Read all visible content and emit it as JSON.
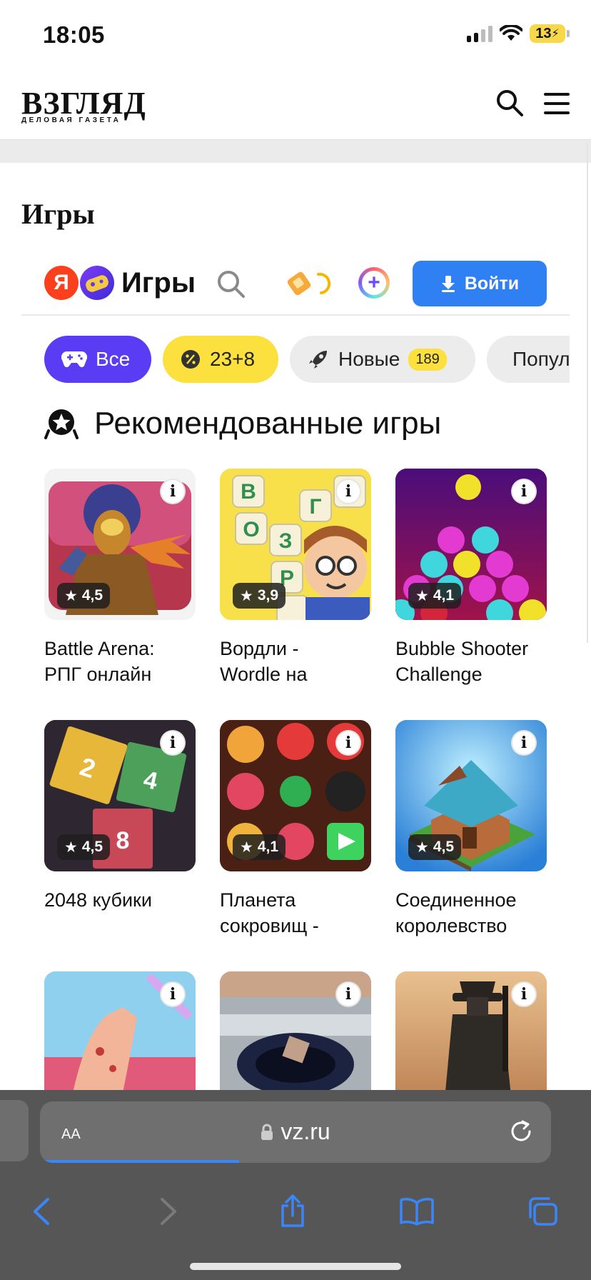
{
  "status_bar": {
    "time": "18:05",
    "battery": "13"
  },
  "site": {
    "logo": "ВЗГЛЯД",
    "logo_sub": "ДЕЛОВАЯ ГАЗЕТА",
    "page_title": "Игры"
  },
  "widget": {
    "yandex_letter": "Я",
    "brand": "Игры",
    "login_label": "Войти"
  },
  "chips": [
    {
      "label": "Все"
    },
    {
      "label": "23+8"
    },
    {
      "label": "Новые",
      "badge": "189"
    },
    {
      "label": "Популярные"
    }
  ],
  "section_title": "Рекомендованные игры",
  "games": [
    {
      "title": "Battle Arena:\nРПГ онлайн",
      "rating": "4,5"
    },
    {
      "title": "Вордли -\nWordle на",
      "rating": "3,9"
    },
    {
      "title": "Bubble Shooter\nChallenge",
      "rating": "4,1"
    },
    {
      "title": "2048 кубики",
      "rating": "4,5"
    },
    {
      "title": "Планета\nсокровищ -",
      "rating": "4,1"
    },
    {
      "title": "Соединенное\nкоролевство",
      "rating": "4,5"
    },
    {
      "title": "",
      "rating": ""
    },
    {
      "title": "",
      "rating": ""
    },
    {
      "title": "",
      "rating": ""
    }
  ],
  "browser": {
    "aa_label": "AA",
    "url": "vz.ru",
    "load_progress": 0.39
  },
  "icons": {
    "info": "i",
    "star": "★",
    "plus": "+"
  },
  "colors": {
    "accent_blue": "#2f80f3",
    "chip_purple": "#5b3cf5",
    "chip_yellow": "#fbe03e",
    "yandex_red": "#fc3f1d"
  }
}
